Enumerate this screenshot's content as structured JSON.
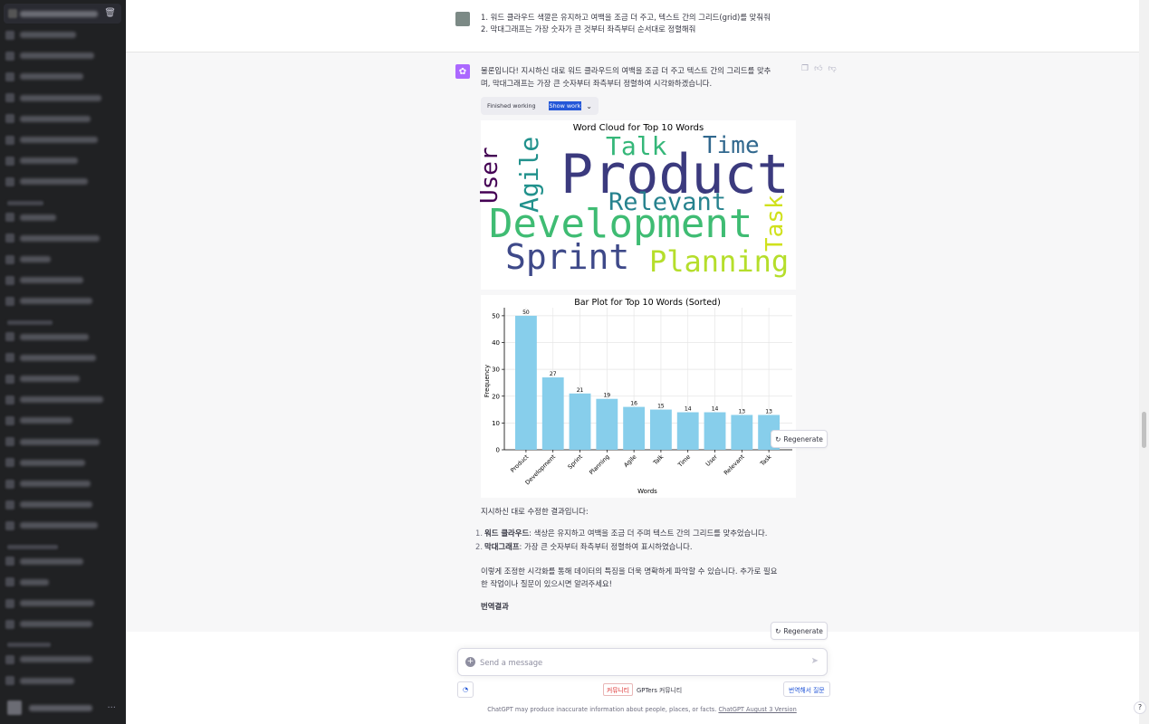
{
  "user_message": {
    "line1": "1. 워드 클라우드 색깔은 유지하고 여백을 조금 더 주고, 텍스트 간의 그리드(grid)를 맞춰줘",
    "line2": "2. 막대그래프는 가장 숫자가 큰 것부터 좌측부터 순서대로 정렬해줘"
  },
  "assistant": {
    "intro_line1": "물론입니다! 지시하신 대로 워드 클라우드의 여백을 조금 더 주고 텍스트 간의 그리드를 맞추",
    "intro_line2": "며, 막대그래프는 가장 큰 숫자부터 좌측부터 정렬하여 시각화하겠습니다.",
    "tool_status": "Finished working",
    "tool_show": "Show work",
    "result_intro": "지시하신 대로 수정한 결과입니다:",
    "list": [
      {
        "num": "1.",
        "bold": "워드 클라우드",
        "rest": ": 색상은 유지하고 여백을 조금 더 주며 텍스트 간의 그리드를 맞추었습니다."
      },
      {
        "num": "2.",
        "bold": "막대그래프",
        "rest": ": 가장 큰 숫자부터 좌측부터 정렬하여 표시하였습니다."
      }
    ],
    "closing_line1": "이렇게 조정한 시각화를 통해 데이터의 특징을 더욱 명확하게 파악할 수 있습니다. 추가로 필요",
    "closing_line2": "한 작업이나 질문이 있으시면 알려주세요!",
    "translation_heading": "번역결과"
  },
  "wordcloud": {
    "title": "Word Cloud for Top 10 Words",
    "words": [
      {
        "text": "Product",
        "color": "#3b3a7e"
      },
      {
        "text": "Talk",
        "color": "#35b779"
      },
      {
        "text": "Time",
        "color": "#31688e"
      },
      {
        "text": "User",
        "color": "#440154"
      },
      {
        "text": "Agile",
        "color": "#21918c"
      },
      {
        "text": "Relevant",
        "color": "#26828e"
      },
      {
        "text": "Development",
        "color": "#3fbc73"
      },
      {
        "text": "Task",
        "color": "#d0e11c"
      },
      {
        "text": "Sprint",
        "color": "#3e4989"
      },
      {
        "text": "Planning",
        "color": "#b5de2b"
      }
    ]
  },
  "chart_data": {
    "type": "bar",
    "title": "Bar Plot for Top 10 Words (Sorted)",
    "xlabel": "Words",
    "ylabel": "Frequency",
    "categories": [
      "Product",
      "Development",
      "Sprint",
      "Planning",
      "Agile",
      "Talk",
      "Time",
      "User",
      "Relevant",
      "Task"
    ],
    "values": [
      50,
      27,
      21,
      19,
      16,
      15,
      14,
      14,
      13,
      13
    ],
    "ylim": [
      0,
      53
    ],
    "yticks": [
      0,
      10,
      20,
      30,
      40,
      50
    ],
    "grid": true,
    "bar_color": "#87ceeb"
  },
  "buttons": {
    "regenerate": "Regenerate"
  },
  "composer": {
    "placeholder": "Send a message"
  },
  "extension": {
    "tag": "커뮤니티",
    "name": "GPTers 커뮤니티",
    "translate_button": "번역해서 질문"
  },
  "footer": {
    "text": "ChatGPT may produce inaccurate information about people, places, or facts. ",
    "link": "ChatGPT August 3 Version"
  },
  "help": "?"
}
